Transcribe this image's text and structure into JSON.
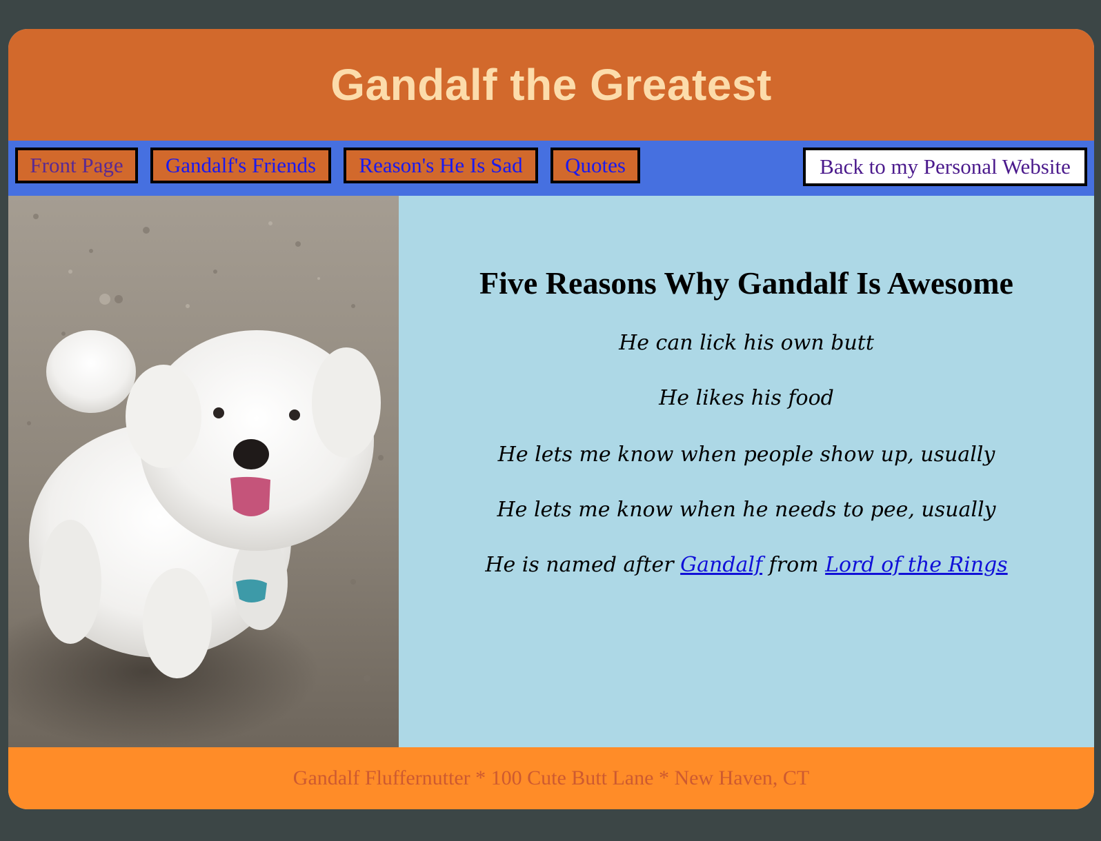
{
  "site": {
    "title": "Gandalf the Greatest"
  },
  "nav": {
    "items": [
      {
        "label": "Front Page"
      },
      {
        "label": "Gandalf's Friends"
      },
      {
        "label": "Reason's He Is Sad"
      },
      {
        "label": "Quotes"
      }
    ],
    "back_label": "Back to my Personal Website"
  },
  "main": {
    "heading": "Five Reasons Why Gandalf Is Awesome",
    "reasons": [
      "He can lick his own butt",
      "He likes his food",
      "He lets me know when people show up, usually",
      "He lets me know when he needs to pee, usually"
    ],
    "last_reason": {
      "prefix": "He is named after ",
      "link1": "Gandalf",
      "middle": " from ",
      "link2": "Lord of the Rings"
    }
  },
  "footer": {
    "text": "Gandalf Fluffernutter * 100 Cute Butt Lane * New Haven, CT"
  },
  "colors": {
    "page_bg": "#3c4646",
    "header_bg": "#d2692c",
    "title_color": "#fcdcab",
    "nav_bg": "#4670e0",
    "content_bg": "#add8e6",
    "footer_bg": "#ff8c28",
    "footer_text": "#cd5a30"
  }
}
